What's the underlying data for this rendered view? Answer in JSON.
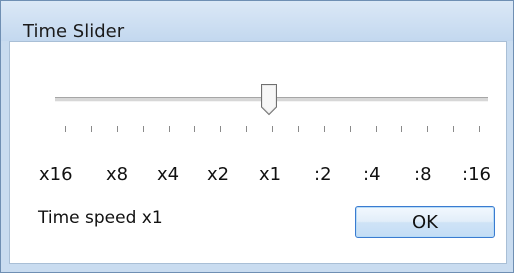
{
  "window": {
    "title": "Time Slider"
  },
  "slider": {
    "labels": [
      "x16",
      "x8",
      "x4",
      "x2",
      "x1",
      ":2",
      ":4",
      ":8",
      ":16"
    ],
    "selected_label": "x1",
    "selected_index": 4,
    "tick_count": 17
  },
  "status_text": "Time speed x1",
  "ok_label": "OK",
  "colors": {
    "frame": "#c9dcf0",
    "button_border": "#3a7bd0"
  }
}
